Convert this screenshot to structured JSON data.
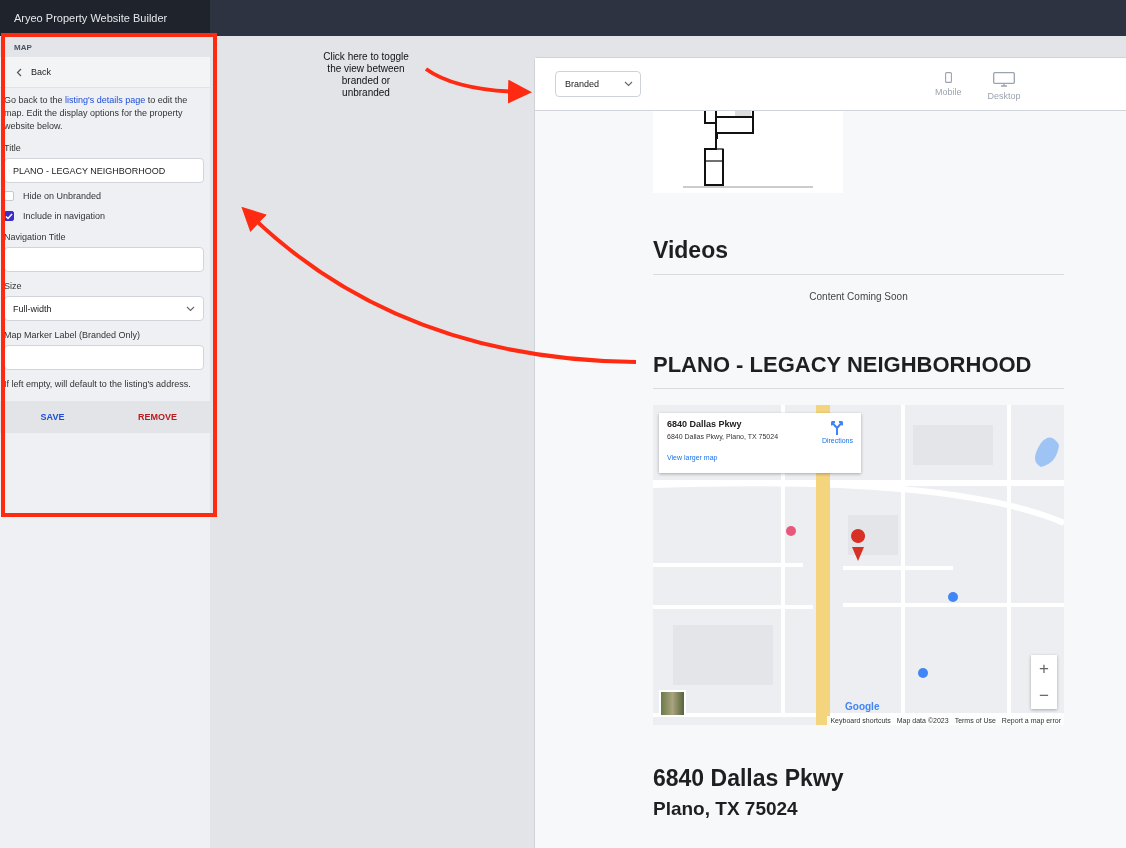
{
  "app_bar": {
    "title": "Aryeo Property Website Builder"
  },
  "panel": {
    "section": "MAP",
    "back": "Back",
    "intro": {
      "before": "Go back to the ",
      "link": "listing's details page",
      "after": " to edit the map. Edit the display options for the property website below."
    },
    "title_field": {
      "label": "Title",
      "value": "PLANO - LEGACY NEIGHBORHOOD"
    },
    "checkboxes": [
      {
        "label": "Hide on Unbranded",
        "checked": false
      },
      {
        "label": "Include in navigation",
        "checked": true
      }
    ],
    "nav_title_field": {
      "label": "Navigation Title"
    },
    "size_select": {
      "label": "Size",
      "value": "Full-width"
    },
    "marker_field": {
      "label": "Map Marker Label (Branded Only)",
      "hint": "If left empty, will default to the listing's address."
    },
    "actions": {
      "save": "SAVE",
      "remove": "REMOVE"
    }
  },
  "annotation": {
    "text": "Click here to toggle the  view between branded or unbranded"
  },
  "preview": {
    "view_select": "Branded",
    "devices": [
      {
        "kind": "mobile",
        "label": "Mobile"
      },
      {
        "kind": "desktop",
        "label": "Desktop"
      }
    ],
    "videos": {
      "heading": "Videos",
      "empty": "Content Coming Soon"
    },
    "map_section": {
      "heading": "PLANO - LEGACY NEIGHBORHOOD",
      "info_card": {
        "name": "6840 Dallas Pkwy",
        "address": "6840 Dallas Pkwy, Plano, TX 75024",
        "directions": "Directions",
        "larger": "View larger map"
      },
      "zoom_in": "+",
      "zoom_out": "−",
      "logo": "Google",
      "footer": [
        "Keyboard shortcuts",
        "Map data ©2023",
        "Terms of Use",
        "Report a map error"
      ]
    },
    "address": {
      "line1": "6840 Dallas Pkwy",
      "line2": "Plano, TX 75024"
    }
  }
}
